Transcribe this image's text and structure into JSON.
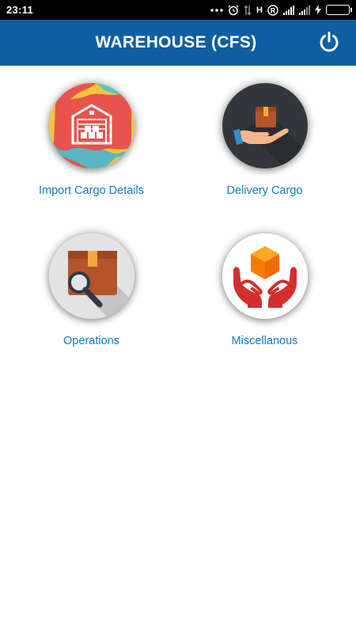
{
  "status_bar": {
    "time": "23:11",
    "icons": [
      "more-dots-icon",
      "alarm-icon",
      "data-arrows-icon",
      "h-network-icon",
      "registered-r-icon",
      "signal-icon",
      "signal-icon-2",
      "charging-bolt-icon",
      "battery-icon"
    ],
    "network_label": "H",
    "r_label": "R",
    "battery_color": "#3fcf3a"
  },
  "app_bar": {
    "title": "WAREHOUSE (CFS)",
    "background": "#0f5fa3",
    "power_icon": "power-icon"
  },
  "menu": {
    "items": [
      {
        "label": "Import Cargo Details",
        "icon": "warehouse-icon"
      },
      {
        "label": "Delivery Cargo",
        "icon": "hand-box-icon"
      },
      {
        "label": "Operations",
        "icon": "box-magnifier-icon"
      },
      {
        "label": "Miscellanous",
        "icon": "hands-cube-icon"
      }
    ],
    "label_color": "#1479c2"
  }
}
